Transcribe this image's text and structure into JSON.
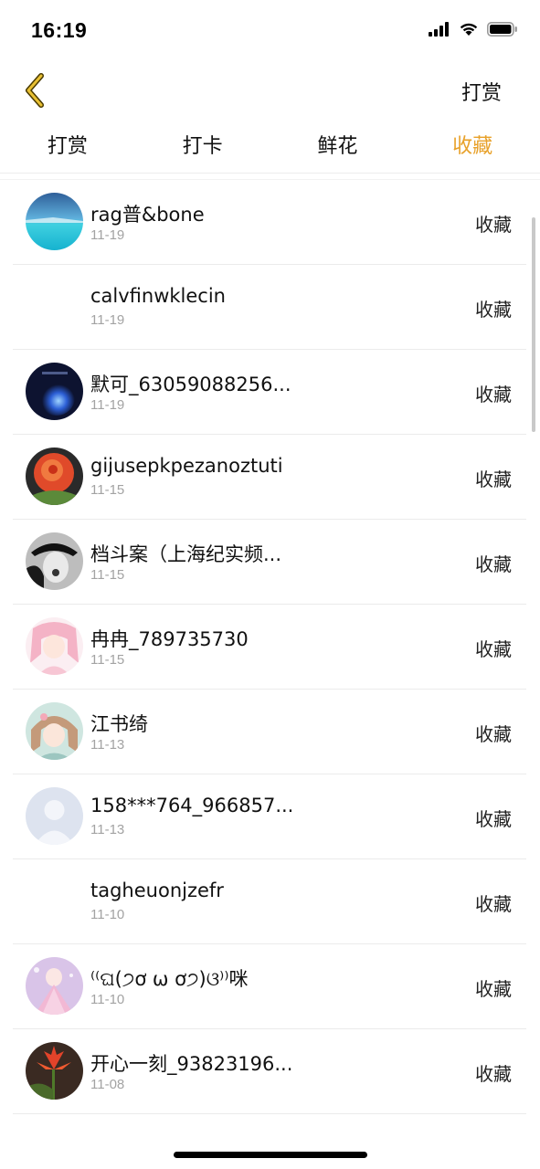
{
  "status": {
    "time": "16:19",
    "icons": [
      "signal-icon",
      "wifi-icon",
      "battery-icon"
    ]
  },
  "nav": {
    "back_icon": "chevron-left-icon",
    "right_label": "打赏",
    "accent_color": "#e8a12a"
  },
  "tabs": [
    {
      "label": "打赏",
      "active": false
    },
    {
      "label": "打卡",
      "active": false
    },
    {
      "label": "鲜花",
      "active": false
    },
    {
      "label": "收藏",
      "active": true
    }
  ],
  "items": [
    {
      "name": "rag普&bone",
      "date": "11-19",
      "action": "收藏",
      "avatar": "sea"
    },
    {
      "name": "calvfinwklecin",
      "date": "11-19",
      "action": "收藏",
      "avatar": "none"
    },
    {
      "name": "默可_63059088256...",
      "date": "11-19",
      "action": "收藏",
      "avatar": "globe"
    },
    {
      "name": "gijusepkpezanoztuti",
      "date": "11-15",
      "action": "收藏",
      "avatar": "rose"
    },
    {
      "name": "档斗案（上海纪实频...",
      "date": "11-15",
      "action": "收藏",
      "avatar": "bw"
    },
    {
      "name": "冉冉_789735730",
      "date": "11-15",
      "action": "收藏",
      "avatar": "pink-girl"
    },
    {
      "name": "江书绮",
      "date": "11-13",
      "action": "收藏",
      "avatar": "anime-girl"
    },
    {
      "name": "158***764_966857...",
      "date": "11-13",
      "action": "收藏",
      "avatar": "default"
    },
    {
      "name": "tagheuonjzefr",
      "date": "11-10",
      "action": "收藏",
      "avatar": "none"
    },
    {
      "name": "⁽⁽ଘ(੭ơ ω ơ੭)ଓ⁾⁾咪",
      "date": "11-10",
      "action": "收藏",
      "avatar": "princess"
    },
    {
      "name": "开心一刻_93823196...",
      "date": "11-08",
      "action": "收藏",
      "avatar": "flower"
    }
  ]
}
